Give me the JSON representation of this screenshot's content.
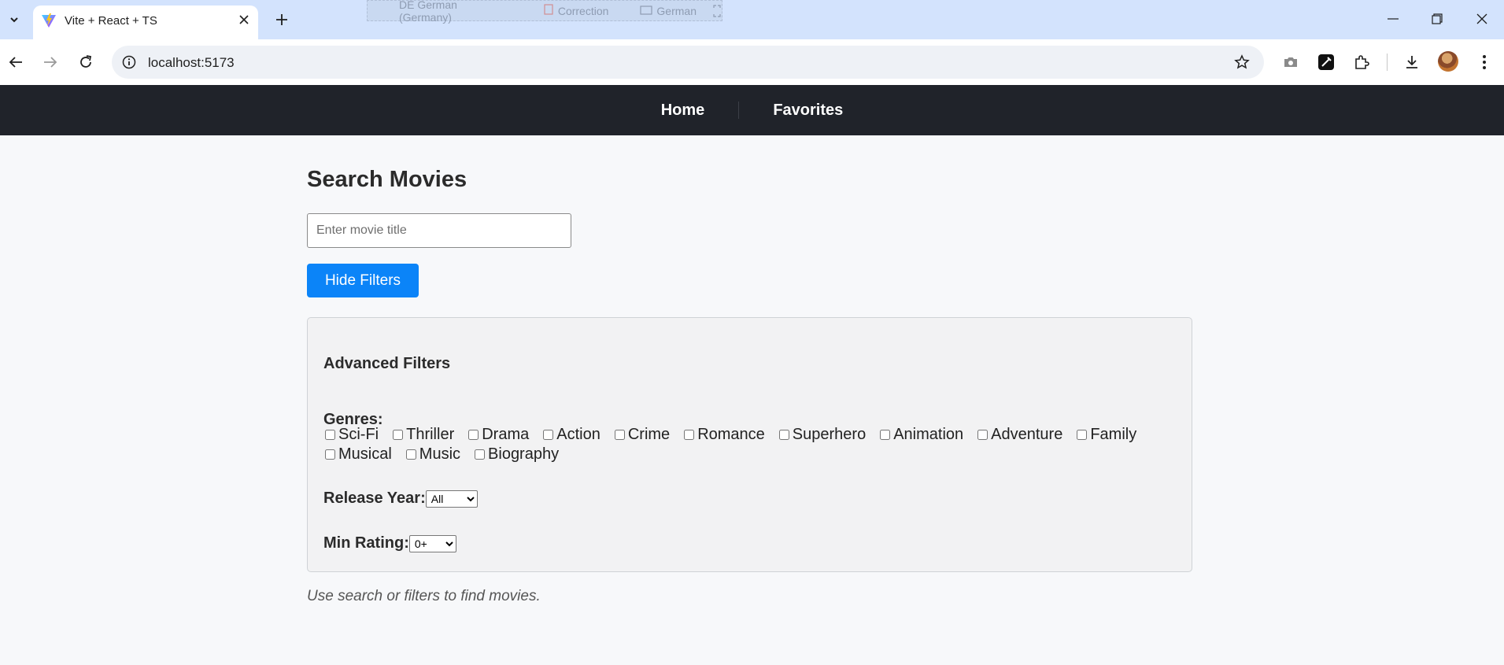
{
  "browser": {
    "tab_title": "Vite + React + TS",
    "url": "localhost:5173",
    "ghost_toolbar": {
      "language": "DE German (Germany)",
      "correction": "Correction",
      "german": "German"
    }
  },
  "nav": {
    "home": "Home",
    "favorites": "Favorites"
  },
  "search": {
    "title": "Search Movies",
    "placeholder": "Enter movie title",
    "value": "",
    "toggle_filters_label": "Hide Filters"
  },
  "filters": {
    "heading": "Advanced Filters",
    "genres_label": "Genres:",
    "genres": [
      "Sci-Fi",
      "Thriller",
      "Drama",
      "Action",
      "Crime",
      "Romance",
      "Superhero",
      "Animation",
      "Adventure",
      "Family",
      "Musical",
      "Music",
      "Biography"
    ],
    "release_year_label": "Release Year:",
    "release_year_value": "All",
    "min_rating_label": "Min Rating:",
    "min_rating_value": "0+"
  },
  "hint": "Use search or filters to find movies.",
  "colors": {
    "tabstrip": "#d3e3fd",
    "navbar": "#20232a",
    "primary_button": "#0b84f8",
    "page_background": "#f7f8fa"
  }
}
